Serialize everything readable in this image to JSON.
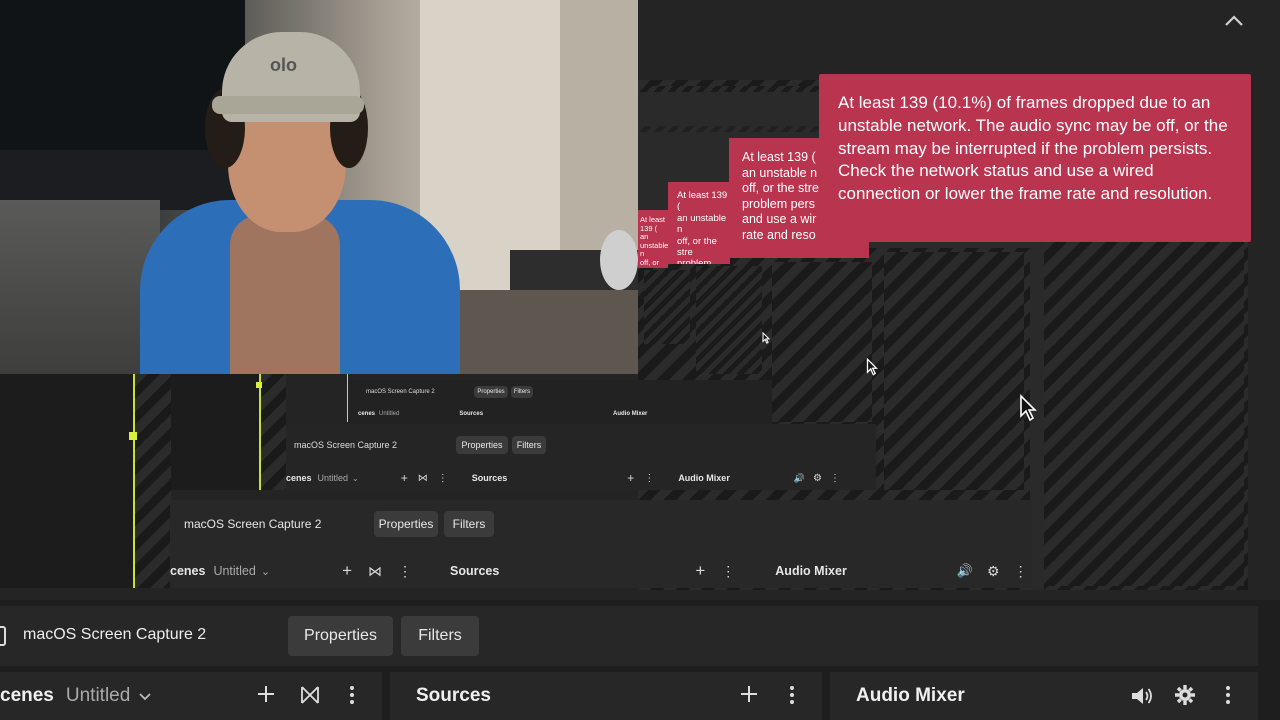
{
  "toast": {
    "message": "At least 139 (10.1%) of frames dropped due to an unstable network. The audio sync may be off, or the stream may be interrupted if the problem persists. Check the network status and use a wired connection or lower the frame rate and resolution.",
    "partial_lines": [
      "At least 139 (",
      "an unstable n",
      "off, or the stre",
      "problem pers",
      "and use a wir",
      "rate and reso"
    ],
    "background_color": "#b8344f"
  },
  "source_bar": {
    "source_name": "macOS Screen Capture 2",
    "properties_label": "Properties",
    "filters_label": "Filters"
  },
  "docks": {
    "scenes_title": "cenes",
    "scene_collection": "Untitled",
    "sources_title": "Sources",
    "audio_mixer_title": "Audio Mixer"
  },
  "icons": {
    "collapse": "chevron-up-icon",
    "add": "plus-icon",
    "transition": "bowtie-icon",
    "menu": "kebab-menu-icon",
    "volume": "speaker-icon",
    "settings": "gear-icon",
    "cursor": "cursor-arrow-icon"
  },
  "colors": {
    "accent_yellow": "#c8e03a",
    "panel": "#272727",
    "background": "#1e1e1e"
  }
}
